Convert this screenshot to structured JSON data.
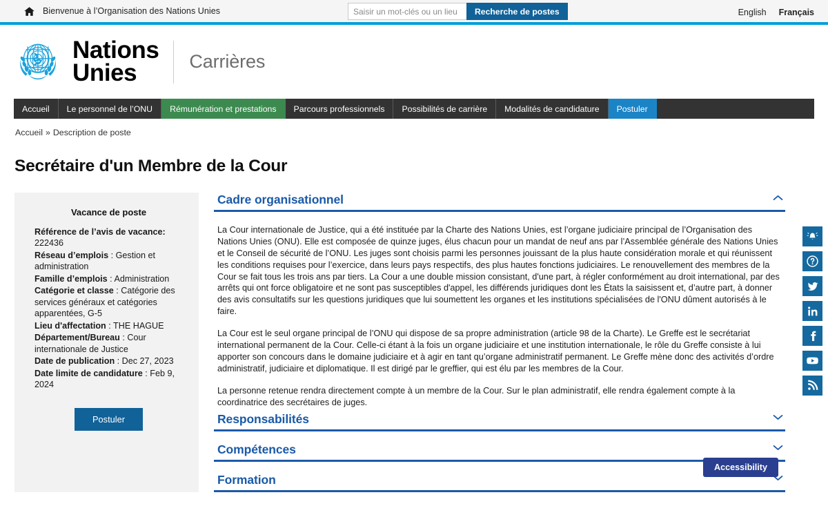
{
  "utility_bar": {
    "home_icon": "home-icon",
    "welcome_text": "Bienvenue à l’Organisation des Nations Unies",
    "search_placeholder": "Saisir un mot-clés ou un lieu",
    "search_value": "",
    "search_button_label": "Recherche de postes",
    "languages": [
      {
        "label": "English",
        "active": false
      },
      {
        "label": "Français",
        "active": true
      }
    ],
    "accent_color": "#009edb"
  },
  "brand": {
    "emblem": "un-emblem-icon",
    "line1": "Nations",
    "line2": "Unies",
    "section": "Carrières",
    "emblem_color": "#009edb"
  },
  "nav": {
    "items": [
      {
        "label": "Accueil",
        "state": "default"
      },
      {
        "label": "Le personnel de l’ONU",
        "state": "default"
      },
      {
        "label": "Rémunération et prestations",
        "state": "green"
      },
      {
        "label": "Parcours professionnels",
        "state": "default"
      },
      {
        "label": "Possibilités de carrière",
        "state": "default"
      },
      {
        "label": "Modalités de candidature",
        "state": "default"
      },
      {
        "label": "Postuler",
        "state": "blue"
      }
    ],
    "bar_color": "#333333",
    "green_color": "#3c8a4f",
    "blue_color": "#1b84c6"
  },
  "breadcrumb": {
    "items": [
      "Accueil",
      "Description de poste"
    ],
    "separator": "»"
  },
  "page_title": "Secrétaire d'un Membre de la Cour",
  "vacancy_card": {
    "title": "Vacance de poste",
    "fields": [
      {
        "label": "Référence de l’avis de vacance",
        "separator": ":",
        "value": "222436"
      },
      {
        "label": "Réseau d’emplois",
        "separator": " :",
        "value": " Gestion et administration"
      },
      {
        "label": "Famille d’emplois",
        "separator": " :",
        "value": " Administration"
      },
      {
        "label": "Catégorie et classe",
        "separator": " :",
        "value": " Catégorie des services généraux et catégories apparentées, G-5"
      },
      {
        "label": "Lieu d'affectation",
        "separator": " :",
        "value": " THE HAGUE"
      },
      {
        "label": "Département/Bureau",
        "separator": " :",
        "value": " Cour internationale de Justice"
      },
      {
        "label": "Date de publication",
        "separator": " :",
        "value": " Dec 27, 2023"
      },
      {
        "label": "Date limite de candidature",
        "separator": " :",
        "value": " Feb 9, 2024"
      }
    ],
    "apply_label": "Postuler",
    "apply_color": "#116299"
  },
  "sections": [
    {
      "title": "Cadre organisationnel",
      "expanded": true,
      "chevron": "chevron-up-icon",
      "paragraphs": [
        "La Cour internationale de Justice, qui a été instituée par la Charte des Nations Unies, est l’organe judiciaire principal de l’Organisation des Nations Unies (ONU). Elle est composée de quinze juges, élus chacun pour un mandat de neuf ans par l’Assemblée générale des Nations Unies et le Conseil de sécurité de l’ONU. Les juges sont choisis parmi les personnes jouissant de la plus haute considération morale et qui réunissent les conditions requises pour l’exercice, dans leurs pays respectifs, des plus hautes fonctions judiciaires. Le renouvellement des membres de la Cour se fait tous les trois ans par tiers. La Cour a une double mission consistant, d'une part, à régler conformément au droit international, par des arrêts qui ont force obligatoire et ne sont pas susceptibles d'appel, les différends juridiques dont les États la saisissent et, d’autre part, à donner des avis consultatifs sur les questions juridiques que lui soumettent les organes et les institutions spécialisées de l'ONU dûment autorisés à le faire.",
        "La Cour est le seul organe principal de l’ONU qui dispose de sa propre administration (article 98 de la Charte). Le Greffe est le secrétariat international permanent de la Cour. Celle-ci étant à la fois un organe judiciaire et une institution internationale, le rôle du Greffe consiste à lui apporter son concours dans le domaine judiciaire et à agir en tant qu’organe administratif permanent. Le Greffe mène donc des activités d’ordre administratif, judiciaire et diplomatique. Il est dirigé par le greffier, qui est élu par les membres de la Cour.",
        "La personne retenue rendra directement compte à un membre de la Cour. Sur le plan administratif, elle rendra également compte à la coordinatrice des secrétaires de juges."
      ]
    },
    {
      "title": "Responsabilités",
      "expanded": false,
      "chevron": "chevron-down-icon",
      "paragraphs": []
    },
    {
      "title": "Compétences",
      "expanded": false,
      "chevron": "chevron-down-icon",
      "paragraphs": []
    },
    {
      "title": "Formation",
      "expanded": false,
      "chevron": "chevron-down-icon",
      "paragraphs": []
    }
  ],
  "social_rail": {
    "color": "#15699f",
    "items": [
      {
        "name": "notification-bell-icon",
        "label": "Alertes"
      },
      {
        "name": "help-question-icon",
        "label": "Aide"
      },
      {
        "name": "twitter-icon",
        "label": "Twitter"
      },
      {
        "name": "linkedin-icon",
        "label": "LinkedIn"
      },
      {
        "name": "facebook-icon",
        "label": "Facebook"
      },
      {
        "name": "youtube-icon",
        "label": "YouTube"
      },
      {
        "name": "rss-icon",
        "label": "RSS"
      }
    ]
  },
  "accessibility_button": {
    "label": "Accessibility",
    "color": "#2a3f8f"
  }
}
